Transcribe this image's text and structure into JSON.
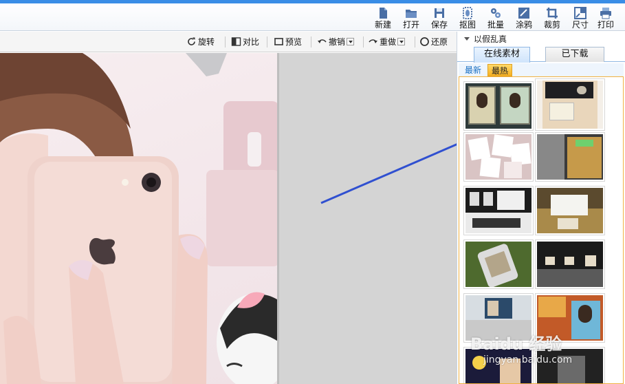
{
  "toolbar": {
    "new_label": "新建",
    "open_label": "打开",
    "save_label": "保存",
    "cutout_label": "抠图",
    "batch_label": "批量",
    "doodle_label": "涂鸦",
    "crop_label": "裁剪",
    "size_label": "尺寸",
    "print_label": "打印"
  },
  "edit_toolbar": {
    "rotate_label": "旋转",
    "compare_label": "对比",
    "preview_label": "预览",
    "undo_label": "撤销",
    "redo_label": "重做",
    "restore_label": "还原"
  },
  "panel": {
    "title": "以假乱真",
    "tabs": [
      {
        "label": "在线素材",
        "active": true
      },
      {
        "label": "已下载",
        "active": false
      }
    ],
    "subtabs": [
      {
        "label": "最新",
        "active": false
      },
      {
        "label": "最热",
        "active": true
      }
    ]
  },
  "watermark": {
    "brand": "Baidu 经验",
    "url": "jingyan.baidu.com"
  },
  "colors": {
    "accent_blue": "#3a8ee6",
    "arrow_blue": "#3050d0",
    "subtab_active": "#f7b021"
  },
  "icons": [
    "new-icon",
    "open-folder-icon",
    "save-disk-icon",
    "cutout-icon",
    "batch-icon",
    "doodle-icon",
    "crop-icon",
    "size-icon",
    "print-icon",
    "rotate-icon",
    "compare-icon",
    "preview-icon",
    "undo-icon",
    "redo-icon",
    "restore-icon"
  ]
}
